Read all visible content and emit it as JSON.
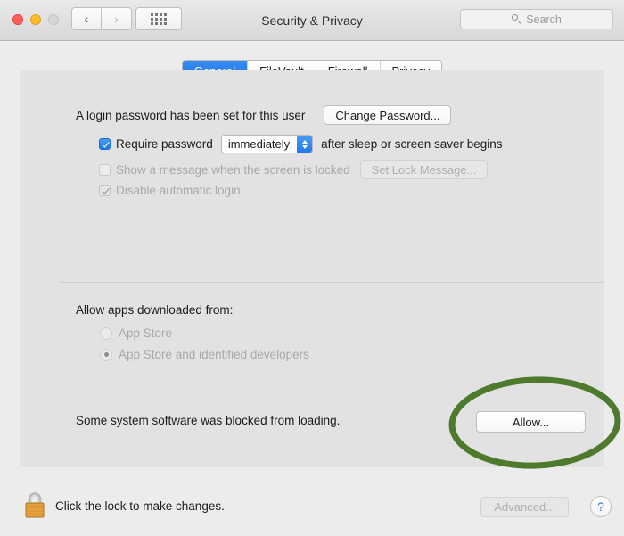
{
  "window": {
    "title": "Security & Privacy",
    "traffic_lights": [
      "close",
      "minimize",
      "zoom"
    ],
    "nav": {
      "back": "‹",
      "forward": "›"
    },
    "show_all_icon": "grid-icon",
    "search": {
      "placeholder": "Search",
      "value": "",
      "icon": "search-icon"
    }
  },
  "tabs": [
    {
      "label": "General",
      "active": true
    },
    {
      "label": "FileVault",
      "active": false
    },
    {
      "label": "Firewall",
      "active": false
    },
    {
      "label": "Privacy",
      "active": false
    }
  ],
  "general": {
    "login_password_text": "A login password has been set for this user",
    "change_password_button": "Change Password...",
    "require_password": {
      "label": "Require password",
      "checked": true,
      "interval_value": "immediately",
      "suffix": "after sleep or screen saver begins"
    },
    "show_message": {
      "label": "Show a message when the screen is locked",
      "checked": false,
      "disabled": true,
      "button": "Set Lock Message..."
    },
    "disable_auto_login": {
      "label": "Disable automatic login",
      "checked": true,
      "disabled": true
    },
    "allow_apps_heading": "Allow apps downloaded from:",
    "allow_apps_options": [
      {
        "label": "App Store",
        "selected": false
      },
      {
        "label": "App Store and identified developers",
        "selected": true
      }
    ],
    "blocked_software_text": "Some system software was blocked from loading.",
    "allow_button": "Allow..."
  },
  "annotation": {
    "shape": "ellipse",
    "color": "#4e7a2e",
    "target": "allow-button"
  },
  "bottom": {
    "lock_icon": "lock-closed-icon",
    "lock_text": "Click the lock to make changes.",
    "advanced_button": "Advanced...",
    "help_button": "?"
  },
  "colors": {
    "accent_blue": "#1f7ae8",
    "window_bg": "#ececec",
    "panel_bg": "#e2e2e2",
    "annotation_green": "#4e7a2e",
    "lock_gold": "#e8a33d"
  }
}
